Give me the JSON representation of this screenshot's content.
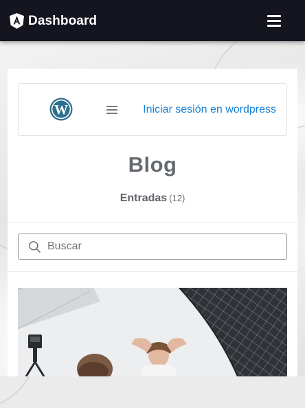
{
  "header": {
    "title": "Dashboard",
    "logo_icon": "angular-shield-icon",
    "menu_icon": "hamburger-icon",
    "bg_color": "#14151f"
  },
  "wordpress_bar": {
    "logo_icon": "wordpress-logo-icon",
    "menu_icon": "hamburger-icon",
    "login_link": "Iniciar sesión en wordpress",
    "link_color": "#1a82d6"
  },
  "blog": {
    "title": "Blog",
    "entries_label": "Entradas",
    "entries_count": "(12)"
  },
  "search": {
    "placeholder": "Buscar",
    "value": ""
  },
  "post": {
    "image": "photo-studio-image"
  }
}
